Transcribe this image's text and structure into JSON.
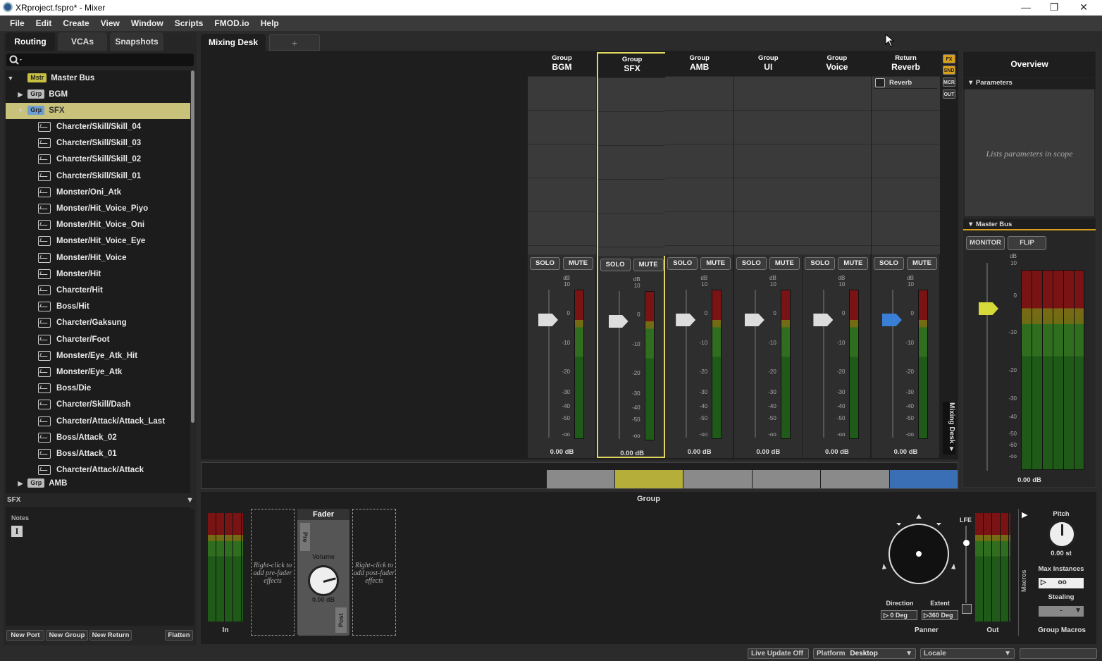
{
  "window": {
    "title": "XRproject.fspro* - Mixer",
    "minimize": "—",
    "maximize": "❐",
    "close": "✕"
  },
  "menu": [
    "File",
    "Edit",
    "Create",
    "View",
    "Window",
    "Scripts",
    "FMOD.io",
    "Help"
  ],
  "left_tabs": [
    "Routing",
    "VCAs",
    "Snapshots"
  ],
  "tree": {
    "master": {
      "badge": "Mstr",
      "label": "Master Bus"
    },
    "bgm": {
      "badge": "Grp",
      "label": "BGM"
    },
    "sfx": {
      "badge": "Grp",
      "label": "SFX"
    },
    "events": [
      "Charcter/Skill/Skill_04",
      "Charcter/Skill/Skill_03",
      "Charcter/Skill/Skill_02",
      "Charcter/Skill/Skill_01",
      "Monster/Oni_Atk",
      "Monster/Hit_Voice_Piyo",
      "Monster/Hit_Voice_Oni",
      "Monster/Hit_Voice_Eye",
      "Monster/Hit_Voice",
      "Monster/Hit",
      "Charcter/Hit",
      "Boss/Hit",
      "Charcter/Gaksung",
      "Charcter/Foot",
      "Monster/Eye_Atk_Hit",
      "Monster/Eye_Atk",
      "Boss/Die",
      "Charcter/Skill/Dash",
      "Charcter/Attack/Attack_Last",
      "Boss/Attack_02",
      "Boss/Attack_01",
      "Charcter/Attack/Attack"
    ],
    "amb": {
      "badge": "Grp",
      "label": "AMB"
    }
  },
  "selection_bar": "SFX",
  "notes": {
    "label": "Notes",
    "icon": "text-cursor-icon"
  },
  "left_buttons": [
    "New Port",
    "New Group",
    "New Return",
    "Flatten"
  ],
  "tabs": {
    "mixing_desk": "Mixing Desk",
    "plus": "+"
  },
  "strips": [
    {
      "kind": "Group",
      "name": "BGM",
      "db": "0.00 dB",
      "color": "#dddddd"
    },
    {
      "kind": "Group",
      "name": "SFX",
      "db": "0.00 dB",
      "color": "#dddddd"
    },
    {
      "kind": "Group",
      "name": "AMB",
      "db": "0.00 dB",
      "color": "#dddddd"
    },
    {
      "kind": "Group",
      "name": "UI",
      "db": "0.00 dB",
      "color": "#dddddd"
    },
    {
      "kind": "Group",
      "name": "Voice",
      "db": "0.00 dB",
      "color": "#dddddd"
    },
    {
      "kind": "Return",
      "name": "Reverb",
      "db": "0.00 dB",
      "color": "#3a7fd6"
    }
  ],
  "solo": "SOLO",
  "mute": "MUTE",
  "reverb_effect": "Reverb",
  "scale": [
    "dB",
    "10",
    "0",
    "-10",
    "-20",
    "-30",
    "-40",
    "-50",
    "-oo"
  ],
  "side_buttons": [
    "FX",
    "SND",
    "MCR",
    "OUT"
  ],
  "side_label": "Mixing Desk",
  "overview": {
    "title": "Overview",
    "parameters": "Parameters",
    "params_hint": "Lists parameters in scope",
    "master_bus": "Master Bus",
    "monitor": "MONITOR",
    "flip": "FLIP",
    "db": "0.00 dB",
    "scale": [
      "dB",
      "10",
      "0",
      "-10",
      "-20",
      "-30",
      "-40",
      "-50",
      "-60",
      "-oo"
    ]
  },
  "bottom": {
    "title": "Group",
    "in": "In",
    "pre_hint": "Right-click to add pre-fader effects",
    "post_hint": "Right-click to add post-fader effects",
    "fader": "Fader",
    "pre": "Pre",
    "post": "Post",
    "volume": "Volume",
    "volume_db": "0.00 dB",
    "lfe": "LFE",
    "direction": "Direction",
    "direction_val": "0 Deg",
    "extent": "Extent",
    "extent_val": "360 Deg",
    "panner": "Panner",
    "out": "Out",
    "macros": "Macros",
    "pitch": "Pitch",
    "pitch_val": "0.00 st",
    "max_instances": "Max Instances",
    "max_val": "oo",
    "stealing": "Stealing",
    "stealing_val": "-",
    "group_macros": "Group Macros"
  },
  "status": {
    "live_update": "Live Update Off",
    "platform": "Platform",
    "platform_val": "Desktop",
    "locale": "Locale",
    "locale_val": ""
  }
}
